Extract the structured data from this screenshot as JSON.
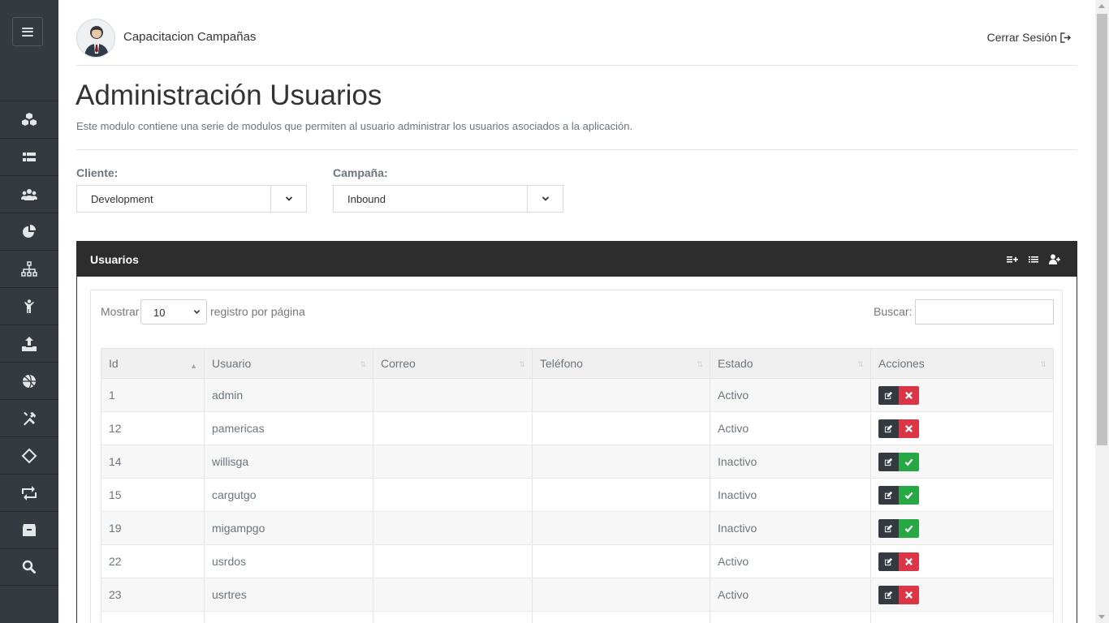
{
  "header": {
    "app_title": "Capacitacion Campañas",
    "logout_label": "Cerrar Sesión"
  },
  "sidebar": {
    "items": [
      {
        "icon": "cubes-icon"
      },
      {
        "icon": "th-list-icon"
      },
      {
        "icon": "users-icon"
      },
      {
        "icon": "pie-chart-icon"
      },
      {
        "icon": "sitemap-icon"
      },
      {
        "icon": "child-icon"
      },
      {
        "icon": "upload-icon"
      },
      {
        "icon": "basketball-icon"
      },
      {
        "icon": "tools-icon"
      },
      {
        "icon": "code-diamond-icon"
      },
      {
        "icon": "retweet-icon"
      },
      {
        "icon": "archive-icon"
      },
      {
        "icon": "search-icon"
      }
    ]
  },
  "page": {
    "title": "Administración Usuarios",
    "description": "Este modulo contiene una serie de modulos que permiten al usuario administrar los usuarios asociados a la aplicación."
  },
  "filters": {
    "client_label": "Cliente:",
    "client_value": "Development",
    "campaign_label": "Campaña:",
    "campaign_value": "Inbound"
  },
  "card": {
    "title": "Usuarios",
    "length_prefix": "Mostrar",
    "length_value": "10",
    "length_suffix": "registro por página",
    "search_label": "Buscar:",
    "search_value": ""
  },
  "table": {
    "columns": [
      "Id",
      "Usuario",
      "Correo",
      "Teléfono",
      "Estado",
      "Acciones"
    ],
    "rows": [
      {
        "id": "1",
        "user": "admin",
        "email": "",
        "phone": "",
        "status": "Activo",
        "action": "delete"
      },
      {
        "id": "12",
        "user": "pamericas",
        "email": "",
        "phone": "",
        "status": "Activo",
        "action": "delete"
      },
      {
        "id": "14",
        "user": "willisga",
        "email": "",
        "phone": "",
        "status": "Inactivo",
        "action": "activate"
      },
      {
        "id": "15",
        "user": "cargutgo",
        "email": "",
        "phone": "",
        "status": "Inactivo",
        "action": "activate"
      },
      {
        "id": "19",
        "user": "migampgo",
        "email": "",
        "phone": "",
        "status": "Inactivo",
        "action": "activate"
      },
      {
        "id": "22",
        "user": "usrdos",
        "email": "",
        "phone": "",
        "status": "Activo",
        "action": "delete"
      },
      {
        "id": "23",
        "user": "usrtres",
        "email": "",
        "phone": "",
        "status": "Activo",
        "action": "delete"
      },
      {
        "id": "",
        "user": "",
        "email": "",
        "phone": "",
        "status": "",
        "action": "none"
      }
    ]
  },
  "colors": {
    "sidebar_bg": "#343a40",
    "card_header_bg": "#2d2d2d",
    "edit_button": "#343a40",
    "delete_button": "#dc3545",
    "activate_button": "#28a745"
  }
}
